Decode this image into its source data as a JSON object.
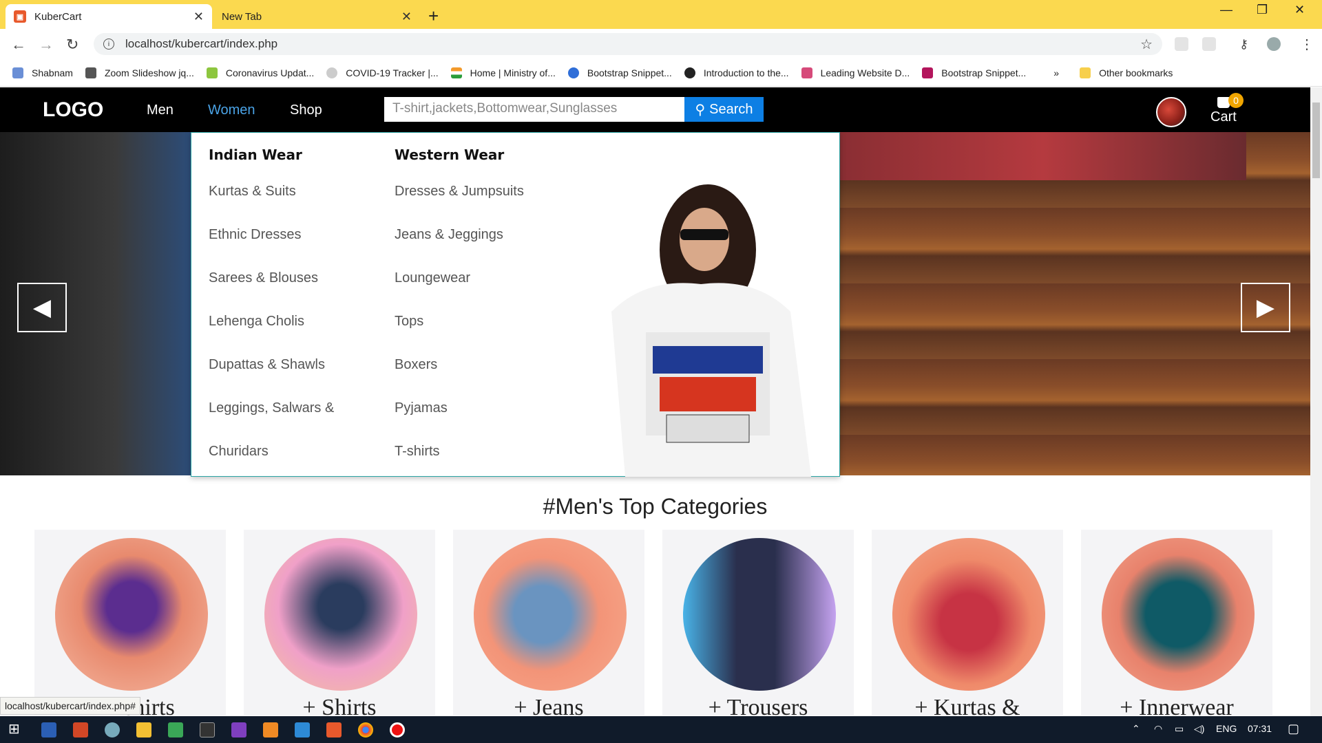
{
  "browser": {
    "tabs": [
      {
        "title": "KuberCart",
        "active": true
      },
      {
        "title": "New Tab",
        "active": false
      }
    ],
    "new_tab_symbol": "+",
    "url": "localhost/kubercart/index.php",
    "bookmarks": [
      "Shabnam",
      "Zoom Slideshow jq...",
      "Coronavirus Updat...",
      "COVID-19 Tracker |...",
      "Home | Ministry of...",
      "Bootstrap Snippet...",
      "Introduction to the...",
      "Leading Website D...",
      "Bootstrap Snippet..."
    ],
    "bookmarks_overflow": "»",
    "other_bookmarks": "Other bookmarks",
    "status_url": "localhost/kubercart/index.php#"
  },
  "site": {
    "logo": "LOGO",
    "nav": [
      "Men",
      "Women",
      "Shop"
    ],
    "search_placeholder": "T-shirt,jackets,Bottomwear,Sunglasses",
    "search_button": "Search",
    "cart_label": "Cart",
    "cart_count": "0"
  },
  "mega_menu": {
    "indian_wear": {
      "heading": "Indian Wear",
      "items": [
        "Kurtas & Suits",
        "Ethnic Dresses",
        "Sarees & Blouses",
        "Lehenga Cholis",
        "Dupattas & Shawls",
        "Leggings, Salwars &",
        "Churidars"
      ]
    },
    "western_wear": {
      "heading": "Western Wear",
      "items": [
        "Dresses & Jumpsuits",
        "Jeans & Jeggings",
        "Loungewear",
        "Tops",
        "Boxers",
        "Pyjamas",
        "T-shirts"
      ]
    }
  },
  "categories": {
    "title": "#Men's Top Categories",
    "items": [
      "+ T-shirts",
      "+ Shirts",
      "+ Jeans",
      "+ Trousers",
      "+ Kurtas &",
      "+ Innerwear"
    ]
  },
  "taskbar": {
    "lang": "ENG",
    "time": "07:31"
  }
}
